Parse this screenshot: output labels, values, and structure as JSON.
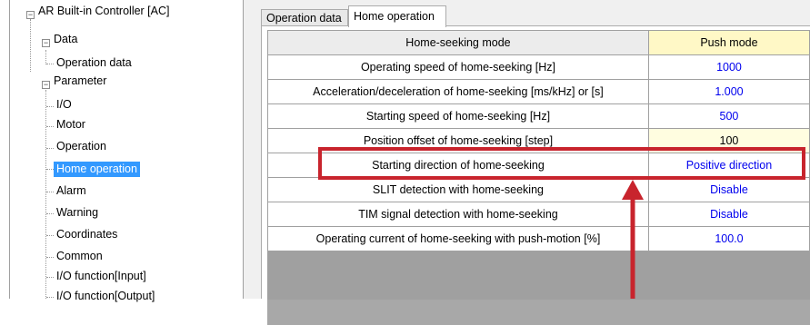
{
  "tree": {
    "root": "AR Built-in Controller [AC]",
    "data_group": "Data",
    "data_items": [
      "Operation data"
    ],
    "parameter_group": "Parameter",
    "parameter_items": [
      "I/O",
      "Motor",
      "Operation",
      "Home operation",
      "Alarm",
      "Warning",
      "Coordinates",
      "Common",
      "I/O function[Input]",
      "I/O function[Output]"
    ],
    "selected": "Home operation"
  },
  "tabs": [
    "Operation data",
    "Home operation"
  ],
  "active_tab": "Home operation",
  "grid": {
    "rows": [
      {
        "label": "Home-seeking mode",
        "value": "Push mode"
      },
      {
        "label": "Operating speed of home-seeking [Hz]",
        "value": "1000"
      },
      {
        "label": "Acceleration/deceleration of home-seeking [ms/kHz] or [s]",
        "value": "1.000"
      },
      {
        "label": "Starting speed of home-seeking [Hz]",
        "value": "500"
      },
      {
        "label": "Position offset of home-seeking [step]",
        "value": "100"
      },
      {
        "label": "Starting direction of home-seeking",
        "value": "Positive direction"
      },
      {
        "label": "SLIT detection with home-seeking",
        "value": "Disable"
      },
      {
        "label": "TIM signal detection with home-seeking",
        "value": "Disable"
      },
      {
        "label": "Operating current of home-seeking with push-motion [%]",
        "value": "100.0"
      }
    ]
  },
  "colors": {
    "annotation": "#c8242d",
    "value_text": "#0000ee",
    "selection": "#3399ff"
  }
}
